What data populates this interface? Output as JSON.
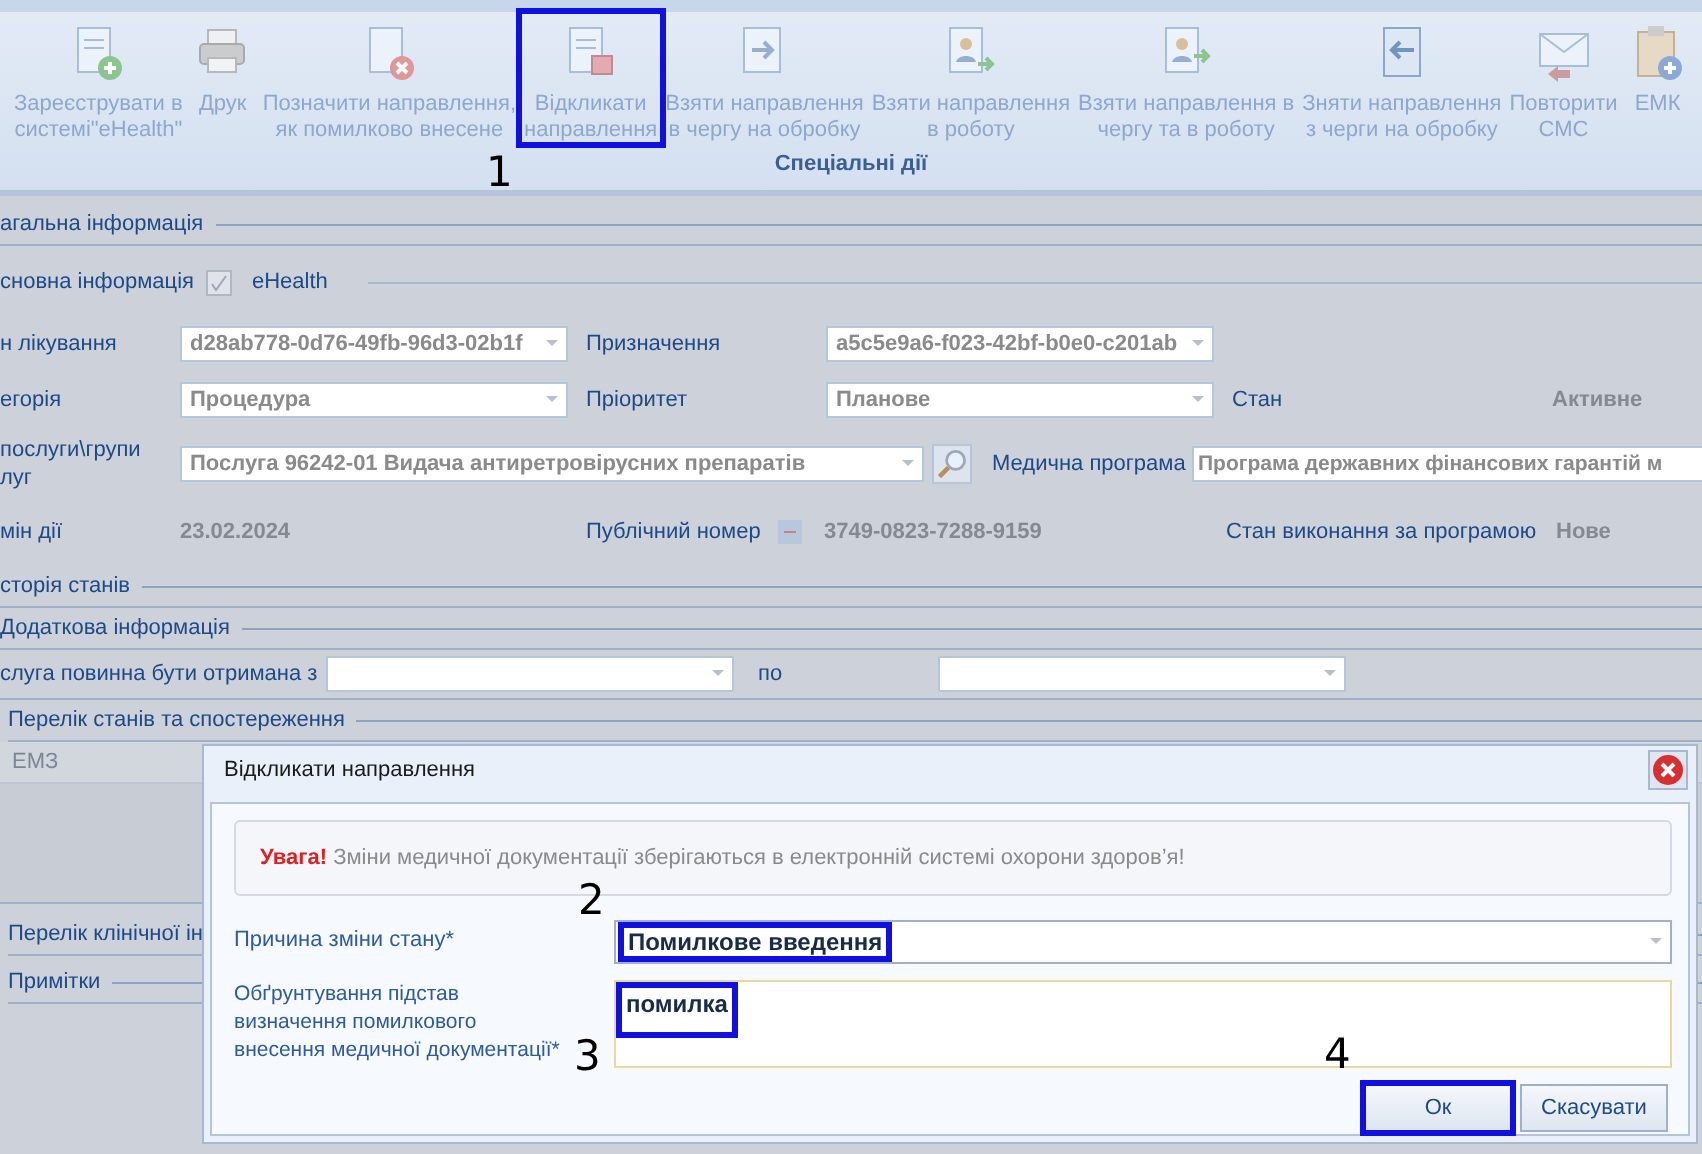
{
  "ribbon": {
    "buttons": [
      {
        "label": "Зареєструвати в\nсистемі\"eHealth\"",
        "disabled": true
      },
      {
        "label": "Друк",
        "disabled": true
      },
      {
        "label": "Позначити направлення,\nяк помилково внесене",
        "disabled": true
      },
      {
        "label": "Відкликати\nнаправлення",
        "disabled": true,
        "annotation": "1"
      },
      {
        "label": "Взяти направлення\nв чергу на обробку",
        "disabled": true
      },
      {
        "label": "Взяти направлення\nв роботу",
        "disabled": true
      },
      {
        "label": "Взяти направлення в\nчергу та в роботу",
        "disabled": true
      },
      {
        "label": "Зняти направлення\nз черги на обробку",
        "disabled": true
      },
      {
        "label": "Повторити\nСМС",
        "disabled": true
      },
      {
        "label": "ЕМК",
        "disabled": true
      }
    ],
    "group_label": "Спеціальні дії"
  },
  "general_info": {
    "title": "агальна інформація"
  },
  "basic_info": {
    "title": "сновна інформація",
    "ehealth": {
      "label": "eHealth",
      "checked": true
    }
  },
  "form": {
    "plan": {
      "label": "н лікування",
      "value": "d28ab778-0d76-49fb-96d3-02b1f"
    },
    "assignment": {
      "label": "Призначення",
      "value": "a5c5e9a6-f023-42bf-b0e0-c201ab"
    },
    "category": {
      "label": "егорія",
      "value": "Процедура"
    },
    "priority": {
      "label": "Пріоритет",
      "value": "Планове"
    },
    "status": {
      "label": "Стан",
      "value": "Активне"
    },
    "service": {
      "label": "послуги\\групи\nлуг",
      "value": "Послуга 96242-01 Видача антиретровірусних препаратів"
    },
    "medical_program": {
      "label": "Медична програма",
      "value": "Програма державних фінансових гарантій м"
    },
    "change_date": {
      "label": "мін дії",
      "value": "23.02.2024"
    },
    "public_number": {
      "label": "Публічний номер",
      "value": "3749-0823-7288-9159"
    },
    "program_status": {
      "label": "Стан виконання за програмою",
      "value": "Нове"
    }
  },
  "status_history": {
    "title": "сторія станів"
  },
  "additional_info": {
    "title": "Додаткова інформація",
    "date_from": {
      "label": "слуга повинна бути отримана з"
    },
    "date_to": {
      "label": "по"
    }
  },
  "conditions": {
    "title": "Перелік станів та спостереження",
    "columns": [
      "ЕМЗ"
    ]
  },
  "clinical": {
    "title": "Перелік клінічної ін"
  },
  "notes": {
    "title": "Примітки"
  },
  "dialog": {
    "title": "Відкликати направлення",
    "warning": "**Увага!** Зміни медичної документації зберігаються в електронній системі охорони здоров’я!",
    "reason": {
      "label": "Причина зміни стану*",
      "value": "Помилкове введення",
      "annotation": "2"
    },
    "justification": {
      "label": "Обґрунтування підстав визначення помилкового внесення медичної документації*",
      "value": "помилка",
      "annotation": "3"
    },
    "buttons": [
      {
        "label": "Ок",
        "annotation": "4"
      },
      {
        "label": "Скасувати"
      }
    ]
  }
}
